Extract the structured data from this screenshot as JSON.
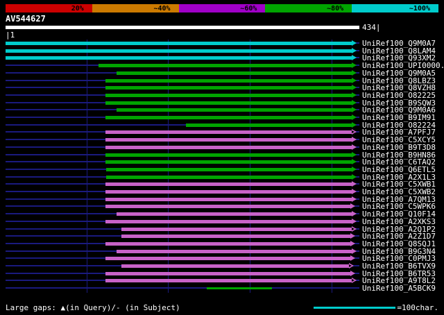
{
  "chart_data": {
    "type": "bar",
    "orientation": "horizontal-range",
    "title": "AV544627",
    "x_range": [
      1,
      434
    ],
    "x_unit": "characters",
    "gridlines_every_chars": 100,
    "identity_scale": [
      {
        "label": "20%",
        "color": "#cc0000"
      },
      {
        "label": "~40%",
        "color": "#cc7a00"
      },
      {
        "label": "~60%",
        "color": "#a000c8"
      },
      {
        "label": "~80%",
        "color": "#00a400"
      },
      {
        "label": "~100%",
        "color": "#00cccc"
      }
    ],
    "rows": [
      {
        "label": "UniRef100_Q9M0A7",
        "color": "cyan",
        "start": 1,
        "end": 431,
        "arrow": "filled"
      },
      {
        "label": "UniRef100_Q8LAM4",
        "color": "cyan",
        "start": 1,
        "end": 431,
        "arrow": "filled"
      },
      {
        "label": "UniRef100_Q93XM2",
        "color": "cyan",
        "start": 1,
        "end": 431,
        "arrow": "filled"
      },
      {
        "label": "UniRef100_UPI0000.",
        "color": "green",
        "start": 115,
        "end": 431,
        "arrow": "filled"
      },
      {
        "label": "UniRef100_Q9M0A5",
        "color": "green",
        "start": 137,
        "end": 431,
        "arrow": "filled"
      },
      {
        "label": "UniRef100_Q8LBZ3",
        "color": "green",
        "start": 123,
        "end": 431,
        "arrow": "filled"
      },
      {
        "label": "UniRef100_Q8VZH8",
        "color": "green",
        "start": 123,
        "end": 431,
        "arrow": "filled"
      },
      {
        "label": "UniRef100_O82225",
        "color": "green",
        "start": 123,
        "end": 431,
        "arrow": "filled"
      },
      {
        "label": "UniRef100_B9SQW3",
        "color": "green",
        "start": 123,
        "end": 431,
        "arrow": "filled"
      },
      {
        "label": "UniRef100_Q9M0A6",
        "color": "green",
        "start": 137,
        "end": 431,
        "arrow": "filled"
      },
      {
        "label": "UniRef100_B9IM91",
        "color": "green",
        "start": 123,
        "end": 431,
        "arrow": "filled"
      },
      {
        "label": "UniRef100_O82224",
        "color": "green",
        "start": 222,
        "end": 431,
        "arrow": "filled"
      },
      {
        "label": "UniRef100_A7PFJ7",
        "color": "magenta",
        "start": 123,
        "end": 431,
        "arrow": "open"
      },
      {
        "label": "UniRef100_C5XCY5",
        "color": "magenta",
        "start": 123,
        "end": 431,
        "arrow": "filled"
      },
      {
        "label": "UniRef100_B9T3D8",
        "color": "magenta",
        "start": 123,
        "end": 431,
        "arrow": "filled"
      },
      {
        "label": "UniRef100_B9HN86",
        "color": "green",
        "start": 123,
        "end": 431,
        "arrow": "filled"
      },
      {
        "label": "UniRef100_C6TAQ2",
        "color": "green",
        "start": 123,
        "end": 431,
        "arrow": "filled"
      },
      {
        "label": "UniRef100_Q6ETL5",
        "color": "green",
        "start": 124,
        "end": 431,
        "arrow": "filled"
      },
      {
        "label": "UniRef100_A2X1L3",
        "color": "green",
        "start": 124,
        "end": 431,
        "arrow": "filled"
      },
      {
        "label": "UniRef100_C5XWB1",
        "color": "magenta",
        "start": 123,
        "end": 431,
        "arrow": "filled"
      },
      {
        "label": "UniRef100_C5XWB2",
        "color": "magenta",
        "start": 123,
        "end": 431,
        "arrow": "filled"
      },
      {
        "label": "UniRef100_A7QM13",
        "color": "magenta",
        "start": 123,
        "end": 431,
        "arrow": "filled"
      },
      {
        "label": "UniRef100_C5WPK6",
        "color": "magenta",
        "start": 123,
        "end": 429,
        "arrow": "filled"
      },
      {
        "label": "UniRef100_Q10F14",
        "color": "magenta",
        "start": 137,
        "end": 431,
        "arrow": "filled"
      },
      {
        "label": "UniRef100_A2XKS3",
        "color": "magenta",
        "start": 123,
        "end": 431,
        "arrow": "filled"
      },
      {
        "label": "UniRef100_A2Q1P2",
        "color": "magenta",
        "start": 143,
        "end": 431,
        "arrow": "open"
      },
      {
        "label": "UniRef100_A2Z1D7",
        "color": "magenta",
        "start": 143,
        "end": 429,
        "arrow": "filled"
      },
      {
        "label": "UniRef100_Q8SQJ1",
        "color": "magenta",
        "start": 123,
        "end": 429,
        "arrow": "filled"
      },
      {
        "label": "UniRef100_B9G3N4",
        "color": "magenta",
        "start": 137,
        "end": 431,
        "arrow": "filled"
      },
      {
        "label": "UniRef100_C0PMJ3",
        "color": "magenta",
        "start": 123,
        "end": 429,
        "arrow": "filled"
      },
      {
        "label": "UniRef100_B6TVX9",
        "color": "magenta",
        "start": 143,
        "end": 427,
        "arrow": "open"
      },
      {
        "label": "UniRef100_B6TR53",
        "color": "magenta",
        "start": 123,
        "end": 429,
        "arrow": "filled"
      },
      {
        "label": "UniRef100_A9T8L2",
        "color": "magenta",
        "start": 123,
        "end": 431,
        "arrow": "open"
      },
      {
        "label": "UniRef100_A5BCK9",
        "color": "green",
        "start": 247,
        "end": 327,
        "arrow": "none"
      }
    ]
  },
  "query": {
    "start_tick": "|1",
    "end_tick": "434|"
  },
  "legend": {
    "gaps_label": "Large gaps: ▲(in Query)/- (in Subject)",
    "scale_label": "=100char.",
    "scale_chars": 100
  },
  "colors": {
    "background": "#000000",
    "text": "#ffffff",
    "backbone": "#1a1a7e",
    "query_bar": "#ffffff",
    "cyan": "#00cccc",
    "green": "#00a400",
    "magenta": "#c862c8"
  }
}
